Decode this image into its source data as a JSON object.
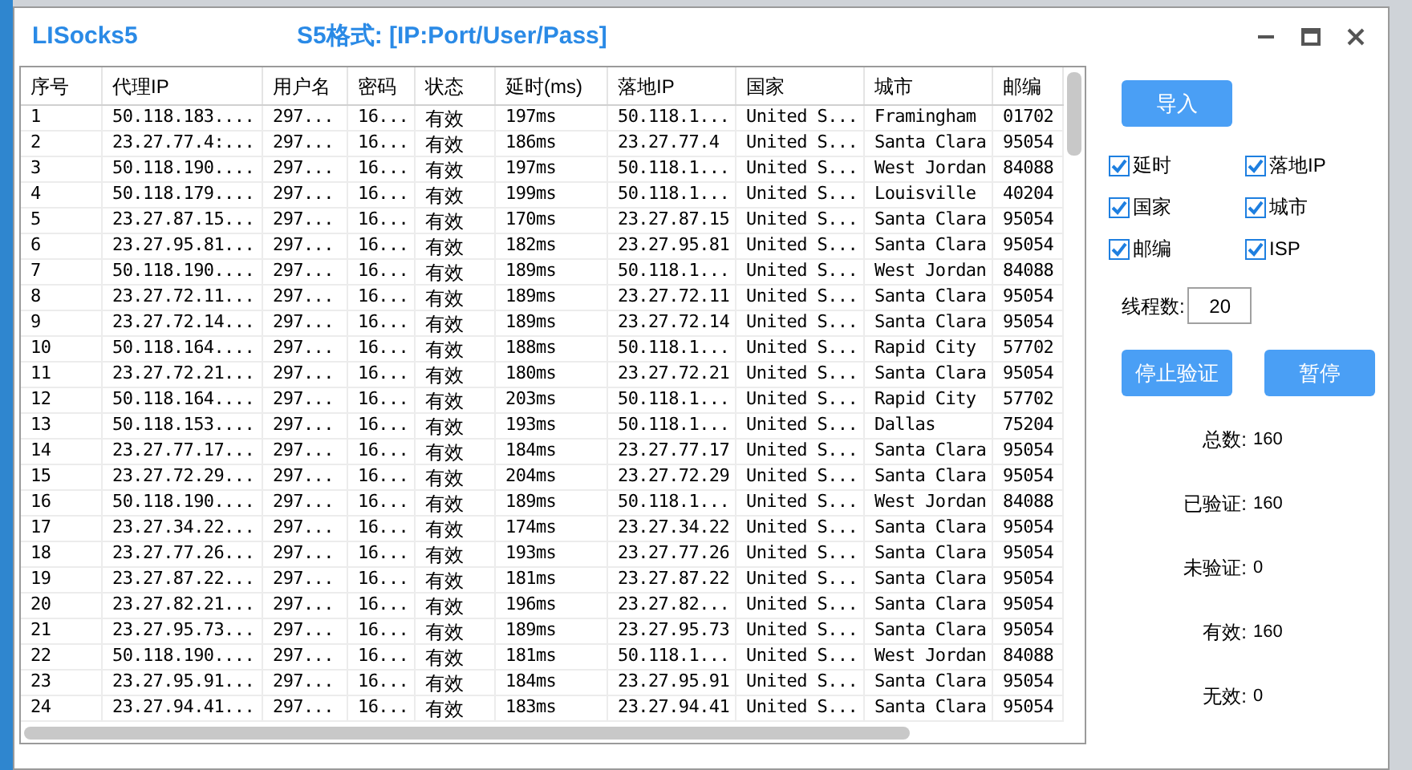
{
  "window": {
    "title": "LISocks5",
    "format_hint": "S5格式: [IP:Port/User/Pass]"
  },
  "table": {
    "columns": [
      "序号",
      "代理IP",
      "用户名",
      "密码",
      "状态",
      "延时(ms)",
      "落地IP",
      "国家",
      "城市",
      "邮编"
    ],
    "rows": [
      [
        "1",
        "50.118.183....",
        "297...",
        "16...",
        "有效",
        "197ms",
        "50.118.1...",
        "United S...",
        "Framingham",
        "01702"
      ],
      [
        "2",
        "23.27.77.4:...",
        "297...",
        "16...",
        "有效",
        "186ms",
        "23.27.77.4",
        "United S...",
        "Santa Clara",
        "95054"
      ],
      [
        "3",
        "50.118.190....",
        "297...",
        "16...",
        "有效",
        "197ms",
        "50.118.1...",
        "United S...",
        "West Jordan",
        "84088"
      ],
      [
        "4",
        "50.118.179....",
        "297...",
        "16...",
        "有效",
        "199ms",
        "50.118.1...",
        "United S...",
        "Louisville",
        "40204"
      ],
      [
        "5",
        "23.27.87.15...",
        "297...",
        "16...",
        "有效",
        "170ms",
        "23.27.87.15",
        "United S...",
        "Santa Clara",
        "95054"
      ],
      [
        "6",
        "23.27.95.81...",
        "297...",
        "16...",
        "有效",
        "182ms",
        "23.27.95.81",
        "United S...",
        "Santa Clara",
        "95054"
      ],
      [
        "7",
        "50.118.190....",
        "297...",
        "16...",
        "有效",
        "189ms",
        "50.118.1...",
        "United S...",
        "West Jordan",
        "84088"
      ],
      [
        "8",
        "23.27.72.11...",
        "297...",
        "16...",
        "有效",
        "189ms",
        "23.27.72.11",
        "United S...",
        "Santa Clara",
        "95054"
      ],
      [
        "9",
        "23.27.72.14...",
        "297...",
        "16...",
        "有效",
        "189ms",
        "23.27.72.14",
        "United S...",
        "Santa Clara",
        "95054"
      ],
      [
        "10",
        "50.118.164....",
        "297...",
        "16...",
        "有效",
        "188ms",
        "50.118.1...",
        "United S...",
        "Rapid City",
        "57702"
      ],
      [
        "11",
        "23.27.72.21...",
        "297...",
        "16...",
        "有效",
        "180ms",
        "23.27.72.21",
        "United S...",
        "Santa Clara",
        "95054"
      ],
      [
        "12",
        "50.118.164....",
        "297...",
        "16...",
        "有效",
        "203ms",
        "50.118.1...",
        "United S...",
        "Rapid City",
        "57702"
      ],
      [
        "13",
        "50.118.153....",
        "297...",
        "16...",
        "有效",
        "193ms",
        "50.118.1...",
        "United S...",
        "Dallas",
        "75204"
      ],
      [
        "14",
        "23.27.77.17...",
        "297...",
        "16...",
        "有效",
        "184ms",
        "23.27.77.17",
        "United S...",
        "Santa Clara",
        "95054"
      ],
      [
        "15",
        "23.27.72.29...",
        "297...",
        "16...",
        "有效",
        "204ms",
        "23.27.72.29",
        "United S...",
        "Santa Clara",
        "95054"
      ],
      [
        "16",
        "50.118.190....",
        "297...",
        "16...",
        "有效",
        "189ms",
        "50.118.1...",
        "United S...",
        "West Jordan",
        "84088"
      ],
      [
        "17",
        "23.27.34.22...",
        "297...",
        "16...",
        "有效",
        "174ms",
        "23.27.34.22",
        "United S...",
        "Santa Clara",
        "95054"
      ],
      [
        "18",
        "23.27.77.26...",
        "297...",
        "16...",
        "有效",
        "193ms",
        "23.27.77.26",
        "United S...",
        "Santa Clara",
        "95054"
      ],
      [
        "19",
        "23.27.87.22...",
        "297...",
        "16...",
        "有效",
        "181ms",
        "23.27.87.22",
        "United S...",
        "Santa Clara",
        "95054"
      ],
      [
        "20",
        "23.27.82.21...",
        "297...",
        "16...",
        "有效",
        "196ms",
        "23.27.82...",
        "United S...",
        "Santa Clara",
        "95054"
      ],
      [
        "21",
        "23.27.95.73...",
        "297...",
        "16...",
        "有效",
        "189ms",
        "23.27.95.73",
        "United S...",
        "Santa Clara",
        "95054"
      ],
      [
        "22",
        "50.118.190....",
        "297...",
        "16...",
        "有效",
        "181ms",
        "50.118.1...",
        "United S...",
        "West Jordan",
        "84088"
      ],
      [
        "23",
        "23.27.95.91...",
        "297...",
        "16...",
        "有效",
        "184ms",
        "23.27.95.91",
        "United S...",
        "Santa Clara",
        "95054"
      ],
      [
        "24",
        "23.27.94.41...",
        "297...",
        "16...",
        "有效",
        "183ms",
        "23.27.94.41",
        "United S...",
        "Santa Clara",
        "95054"
      ]
    ]
  },
  "import_button": "导入",
  "options": [
    {
      "label": "延时",
      "checked": true
    },
    {
      "label": "落地IP",
      "checked": true
    },
    {
      "label": "国家",
      "checked": true
    },
    {
      "label": "城市",
      "checked": true
    },
    {
      "label": "邮编",
      "checked": true
    },
    {
      "label": "ISP",
      "checked": true
    }
  ],
  "threads": {
    "label": "线程数:",
    "value": "20"
  },
  "action_buttons": [
    "停止验证",
    "暂停"
  ],
  "stats": [
    {
      "label": "总数:",
      "value": "160"
    },
    {
      "label": "已验证:",
      "value": "160"
    },
    {
      "label": "未验证:",
      "value": "0"
    },
    {
      "label": "有效:",
      "value": "160"
    },
    {
      "label": "无效:",
      "value": "0"
    }
  ]
}
